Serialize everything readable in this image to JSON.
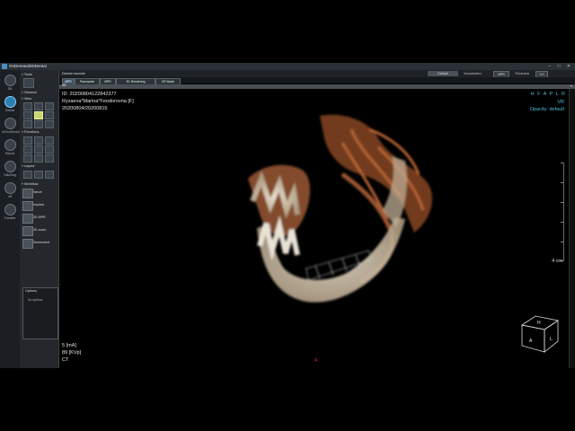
{
  "window": {
    "title": "OnDemand3DDental",
    "controls": "– □ ✕"
  },
  "nav": [
    {
      "label": "DB",
      "icon": "database-icon"
    },
    {
      "label": "Dental",
      "icon": "tooth-icon",
      "active": true
    },
    {
      "label": "InVivoDental",
      "icon": "implant-icon"
    },
    {
      "label": "Report",
      "icon": "report-icon"
    },
    {
      "label": "Stitching",
      "icon": "stitch-icon"
    },
    {
      "label": "VR",
      "icon": "vr-icon"
    },
    {
      "label": "Transfer",
      "icon": "transfer-icon"
    }
  ],
  "panel": {
    "tools_title": "Tools",
    "tools_label": "Tools",
    "general_title": "General",
    "view_title": "View",
    "functions_title": "Functions",
    "layout_title": "Layout",
    "workflow_title": "Workflow",
    "workflow_items": [
      "Nerve",
      "Implant",
      "3D MPR",
      "3D zoom",
      "Screenshot"
    ],
    "options_title": "Options",
    "options_text": "No options"
  },
  "toolbar": {
    "module_title": "Dental module",
    "action_button": "Default",
    "visualization_label": "Visualization",
    "visualization_value": "MPR",
    "thickness_label": "Thickness",
    "thickness_value": "0.0"
  },
  "tabs": [
    "MPR",
    "Panoramic",
    "MPR",
    "3D Rendering",
    "VR Mode"
  ],
  "view": {
    "number": "3D",
    "id": "ID: 20200804122842377",
    "patient": "Ryzaeva*Marina*Feodorovna [F]",
    "dates": "20200804/20200815",
    "orientation": "H F A P L R",
    "mode": "VR",
    "preset": "Opacity: default",
    "scale": "4 cm",
    "ma": "5 [mA]",
    "kvp": "89 [KVp]",
    "modality": "CT",
    "marker": "✕",
    "cube": {
      "top": "H",
      "left": "A",
      "right": "L"
    }
  },
  "colors": {
    "accent": "#4fb9d6",
    "bone": "#e8d9c2",
    "vessel": "#a5542a"
  }
}
